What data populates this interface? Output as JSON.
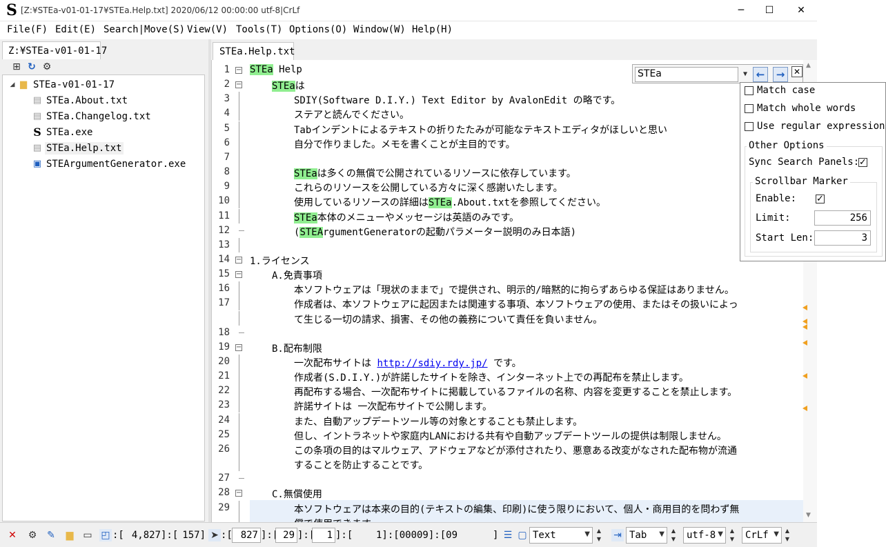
{
  "window": {
    "title": "[Z:¥STEa-v01-01-17¥STEa.Help.txt] 2020/06/12 00:00:00 utf-8|CrLf",
    "minimize": "─",
    "maximize": "☐",
    "close": "✕",
    "app_icon": "S"
  },
  "menu": [
    "File(F)",
    "Edit(E)",
    "Search|Move(S)",
    "View(V)",
    "Tools(T)",
    "Options(O)",
    "Window(W)",
    "Help(H)"
  ],
  "explorer": {
    "tab_label": "Z:¥STEa-v01-01-17",
    "toolbar_icons": [
      "tree-icon",
      "refresh-icon",
      "gear-icon"
    ],
    "root": "STEa-v01-01-17",
    "files": [
      {
        "name": "STEa.About.txt",
        "icon": "text-file-icon"
      },
      {
        "name": "STEa.Changelog.txt",
        "icon": "text-file-icon"
      },
      {
        "name": "STEa.exe",
        "icon": "app-icon"
      },
      {
        "name": "STEa.Help.txt",
        "icon": "text-file-icon"
      },
      {
        "name": "STEArgumentGenerator.exe",
        "icon": "exe-icon"
      }
    ]
  },
  "editor": {
    "tab_label": "STEa.Help.txt",
    "lines": [
      {
        "n": "1",
        "segs": [
          {
            "t": "STEa",
            "h": true
          },
          {
            "t": " Help"
          }
        ]
      },
      {
        "n": "2",
        "segs": [
          {
            "t": "STEa",
            "h": true
          },
          {
            "t": "は"
          }
        ]
      },
      {
        "n": "3",
        "segs": [
          {
            "t": "SDIY(Software D.I.Y.) Text Editor by AvalonEdit の略です。"
          }
        ]
      },
      {
        "n": "4",
        "segs": [
          {
            "t": "ステアと読んでください。"
          }
        ]
      },
      {
        "n": "5",
        "segs": [
          {
            "t": "Tabインデントによるテキストの折りたたみが可能なテキストエディタがほしいと思い"
          }
        ]
      },
      {
        "n": "6",
        "segs": [
          {
            "t": "自分で作りました。メモを書くことが主目的です。"
          }
        ]
      },
      {
        "n": "7",
        "segs": []
      },
      {
        "n": "8",
        "segs": [
          {
            "t": "STEa",
            "h": true
          },
          {
            "t": "は多くの無償で公開されているリソースに依存しています。"
          }
        ]
      },
      {
        "n": "9",
        "segs": [
          {
            "t": "これらのリソースを公開している方々に深く感謝いたします。"
          }
        ]
      },
      {
        "n": "10",
        "segs": [
          {
            "t": "使用しているリソースの詳細は"
          },
          {
            "t": "STEa",
            "h": true
          },
          {
            "t": ".About.txtを参照してください。"
          }
        ]
      },
      {
        "n": "11",
        "segs": [
          {
            "t": "STEa",
            "h": true
          },
          {
            "t": "本体のメニューやメッセージは英語のみです。"
          }
        ]
      },
      {
        "n": "12",
        "segs": [
          {
            "t": "("
          },
          {
            "t": "STEA",
            "h": true
          },
          {
            "t": "rgumentGeneratorの起動パラメーター説明のみ日本語)"
          }
        ]
      },
      {
        "n": "13",
        "segs": []
      },
      {
        "n": "14",
        "segs": [
          {
            "t": "1.ライセンス"
          }
        ]
      },
      {
        "n": "15",
        "segs": [
          {
            "t": "A.免責事項"
          }
        ]
      },
      {
        "n": "16",
        "segs": [
          {
            "t": "本ソフトウェアは「現状のままで」で提供され、明示的/暗黙的に拘らずあらゆる保証はありません。"
          }
        ]
      },
      {
        "n": "17",
        "segs": [
          {
            "t": "作成者は、本ソフトウェアに起因または関連する事項、本ソフトウェアの使用、またはその扱いによっ"
          }
        ]
      },
      {
        "n": "",
        "segs": [
          {
            "t": "て生じる一切の請求、損害、その他の義務について責任を負いません。"
          }
        ]
      },
      {
        "n": "18",
        "segs": []
      },
      {
        "n": "19",
        "segs": [
          {
            "t": "B.配布制限"
          }
        ]
      },
      {
        "n": "20",
        "segs": [
          {
            "t": "一次配布サイトは "
          },
          {
            "t": "http://sdiy.rdy.jp/",
            "link": true
          },
          {
            "t": " です。"
          }
        ]
      },
      {
        "n": "21",
        "segs": [
          {
            "t": "作成者(S.D.I.Y.)が許諾したサイトを除き、インターネット上での再配布を禁止します。"
          }
        ]
      },
      {
        "n": "22",
        "segs": [
          {
            "t": "再配布する場合、一次配布サイトに掲載しているファイルの名称、内容を変更することを禁止します。"
          }
        ]
      },
      {
        "n": "23",
        "segs": [
          {
            "t": "許諾サイトは 一次配布サイトで公開します。"
          }
        ]
      },
      {
        "n": "24",
        "segs": [
          {
            "t": "また、自動アップデートツール等の対象とすることも禁止します。"
          }
        ]
      },
      {
        "n": "25",
        "segs": [
          {
            "t": "但し、イントラネットや家庭内LANにおける共有や自動アップデートツールの提供は制限しません。"
          }
        ]
      },
      {
        "n": "26",
        "segs": [
          {
            "t": "この条項の目的はマルウェア、アドウェアなどが添付されたり、悪意ある改変がなされた配布物が流通"
          }
        ]
      },
      {
        "n": "",
        "segs": [
          {
            "t": "することを防止することです。"
          }
        ]
      },
      {
        "n": "27",
        "segs": []
      },
      {
        "n": "28",
        "segs": [
          {
            "t": "C.無償使用"
          }
        ]
      },
      {
        "n": "29",
        "segs": [
          {
            "t": "本ソフトウェアは本来の目的(テキストの編集、印刷)に使う限りにおいて、個人・商用目的を問わず無"
          }
        ]
      },
      {
        "n": "",
        "segs": [
          {
            "t": "償で使用できます。"
          }
        ]
      }
    ]
  },
  "search": {
    "query": "STEa",
    "prev_icon": "arrow-left-icon",
    "next_icon": "arrow-right-icon",
    "close": "✕",
    "match_case": "Match case",
    "match_whole_words": "Match whole words",
    "use_regex": "Use regular expressions",
    "other_options": "Other Options",
    "sync_panels": "Sync Search Panels:",
    "sync_checked": "✓",
    "scrollbar_marker": "Scrollbar Marker",
    "enable": "Enable:",
    "enable_checked": "✓",
    "limit_label": "Limit:",
    "limit_value": "256",
    "start_len_label": "Start Len:",
    "start_len_value": "3"
  },
  "status": {
    "close_icon": "✕",
    "pos_prefix": ":[",
    "pos_value": "4,827",
    "pos_sep": "]:[",
    "line_count": "157]",
    "sel_prefix": ":[",
    "sel_value": "827",
    "sel_sep1": "]:[",
    "col_value": "29",
    "sel_sep2": "]:[",
    "extra_value": "1",
    "rest": "]:[    1]:[00009]:[09",
    "rest_end": "]",
    "mode": "Text",
    "indent": "Tab",
    "encoding": "utf-8",
    "eol": "CrLf"
  }
}
